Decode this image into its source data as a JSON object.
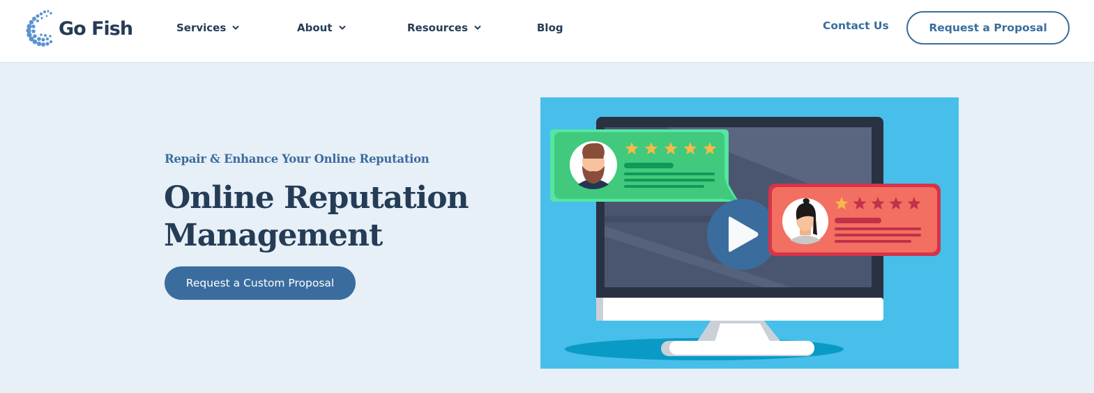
{
  "header": {
    "logo_text": "Go Fish",
    "nav": [
      {
        "label": "Services",
        "has_dropdown": true
      },
      {
        "label": "About",
        "has_dropdown": true
      },
      {
        "label": "Resources",
        "has_dropdown": true
      },
      {
        "label": "Blog",
        "has_dropdown": false
      }
    ],
    "contact_label": "Contact Us",
    "proposal_label": "Request a Proposal"
  },
  "hero": {
    "eyebrow": "Repair & Enhance Your Online Reputation",
    "title_line1": "Online Reputation",
    "title_line2": "Management",
    "cta_label": "Request a Custom Proposal",
    "media": {
      "type": "video-thumbnail",
      "icon": "play-icon",
      "reviews": [
        {
          "sentiment": "positive",
          "rating": 5,
          "max_rating": 5,
          "avatar": "man-avatar",
          "bubble_color": "#41c97d"
        },
        {
          "sentiment": "negative",
          "rating": 1,
          "max_rating": 5,
          "avatar": "woman-avatar",
          "bubble_color": "#f26f61"
        }
      ]
    }
  },
  "colors": {
    "brand_navy": "#253c56",
    "brand_blue": "#3a6d9e",
    "page_bg": "#e7eff7",
    "image_bg": "#47bfea",
    "star_gold": "#f7b948",
    "star_empty": "#c2304a"
  }
}
